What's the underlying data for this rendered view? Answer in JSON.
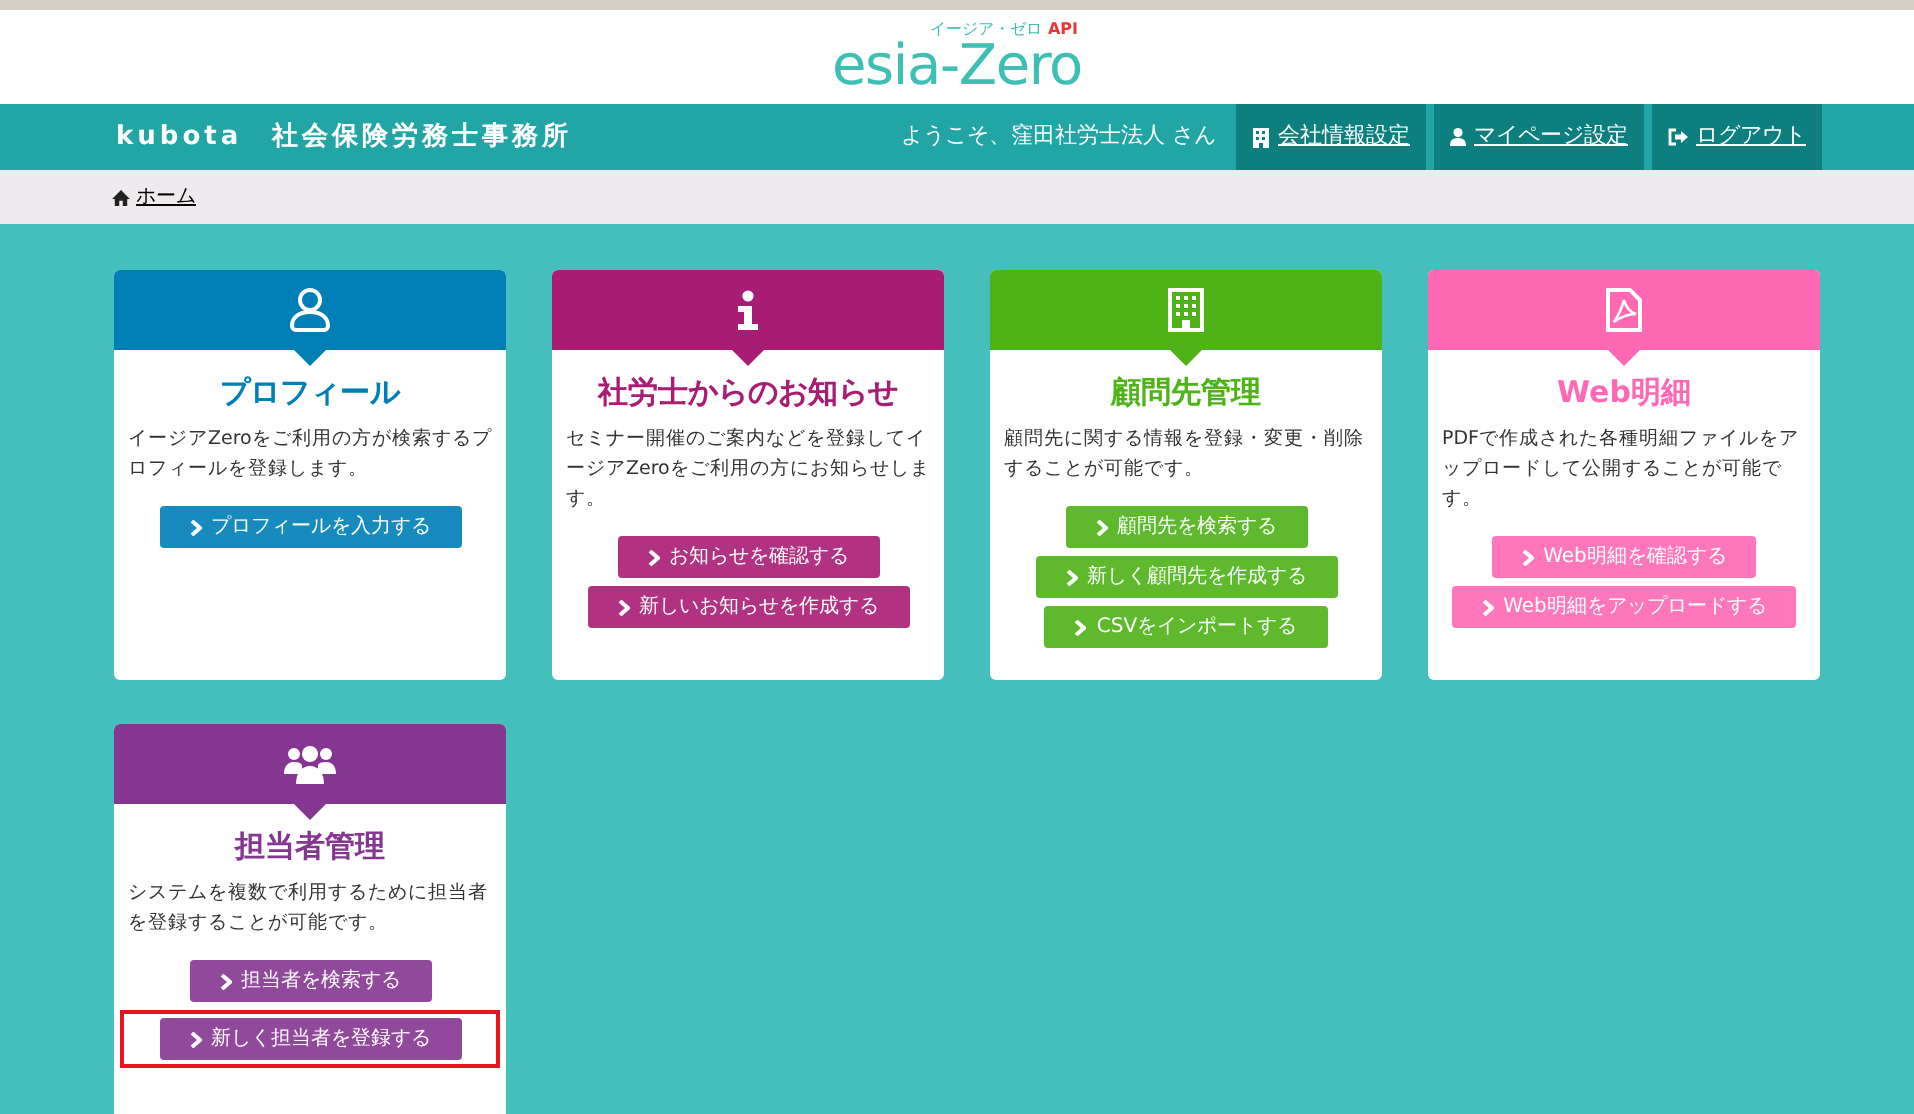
{
  "logo": {
    "text": "esia-Zero",
    "badge": "API",
    "reading": "イージア・ゼロ"
  },
  "header": {
    "company": "kubota　社会保険労務士事務所",
    "welcome": "ようこそ、窪田社労士法人 さん",
    "links": [
      {
        "kind": "building",
        "label": "会社情報設定"
      },
      {
        "kind": "user",
        "label": "マイページ設定"
      },
      {
        "kind": "logout",
        "label": "ログアウト"
      }
    ]
  },
  "breadcrumb": {
    "label": "ホーム"
  },
  "cards": [
    {
      "kind": "user",
      "color": "#007fb7",
      "title": "プロフィール",
      "description": "イージアZeroをご利用の方が検索するプロフィールを登録します。",
      "buttons": [
        {
          "label": "プロフィールを入力する",
          "highlighted": false
        }
      ]
    },
    {
      "kind": "info",
      "color": "#a91c73",
      "title": "社労士からのお知らせ",
      "description": "セミナー開催のご案内などを登録してイージアZeroをご利用の方にお知らせします。",
      "buttons": [
        {
          "label": "お知らせを確認する",
          "highlighted": false
        },
        {
          "label": "新しいお知らせを作成する",
          "highlighted": false
        }
      ]
    },
    {
      "kind": "building",
      "color": "#4db316",
      "title": "顧問先管理",
      "description": "顧問先に関する情報を登録・変更・削除することが可能です。",
      "buttons": [
        {
          "label": "顧問先を検索する",
          "highlighted": false
        },
        {
          "label": "新しく顧問先を作成する",
          "highlighted": false
        },
        {
          "label": "CSVをインポートする",
          "highlighted": false
        }
      ]
    },
    {
      "kind": "pdf",
      "color": "#ff69b4",
      "title": "Web明細",
      "description": "PDFで作成された各種明細ファイルをアップロードして公開することが可能です。",
      "buttons": [
        {
          "label": "Web明細を確認する",
          "highlighted": false
        },
        {
          "label": "Web明細をアップロードする",
          "highlighted": false
        }
      ]
    },
    {
      "kind": "group",
      "color": "#853691",
      "title": "担当者管理",
      "description": "システムを複数で利用するために担当者を登録することが可能です。",
      "buttons": [
        {
          "label": "担当者を検索する",
          "highlighted": false
        },
        {
          "label": "新しく担当者を登録する",
          "highlighted": true
        }
      ]
    }
  ]
}
